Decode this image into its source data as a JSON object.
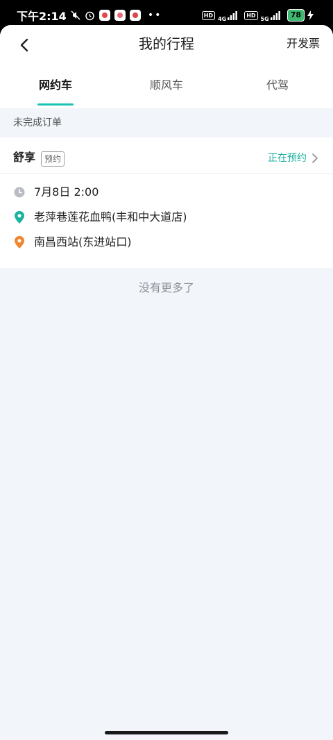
{
  "status_bar": {
    "time": "下午2:14",
    "net1": "4G",
    "net2": "5G",
    "hd": "HD",
    "battery": "78",
    "colors": {
      "battery": "#3fb873"
    }
  },
  "header": {
    "title": "我的行程",
    "right_action": "开发票",
    "back_icon": "chevron-left-icon"
  },
  "tabs": [
    {
      "label": "网约车",
      "active": true
    },
    {
      "label": "顺风车",
      "active": false
    },
    {
      "label": "代驾",
      "active": false
    }
  ],
  "section": {
    "label": "未完成订单"
  },
  "order": {
    "service": "舒享",
    "tag": "预约",
    "status": "正在预约",
    "time": "7月8日 2:00",
    "origin": "老萍巷莲花血鸭(丰和中大道店)",
    "destination": "南昌西站(东进站口)",
    "colors": {
      "origin": "#19b3a0",
      "destination": "#f0852d",
      "status": "#19b3a0"
    }
  },
  "footer": {
    "no_more": "没有更多了"
  },
  "theme": {
    "accent": "#19c3b0",
    "background": "#f2f5f9"
  }
}
